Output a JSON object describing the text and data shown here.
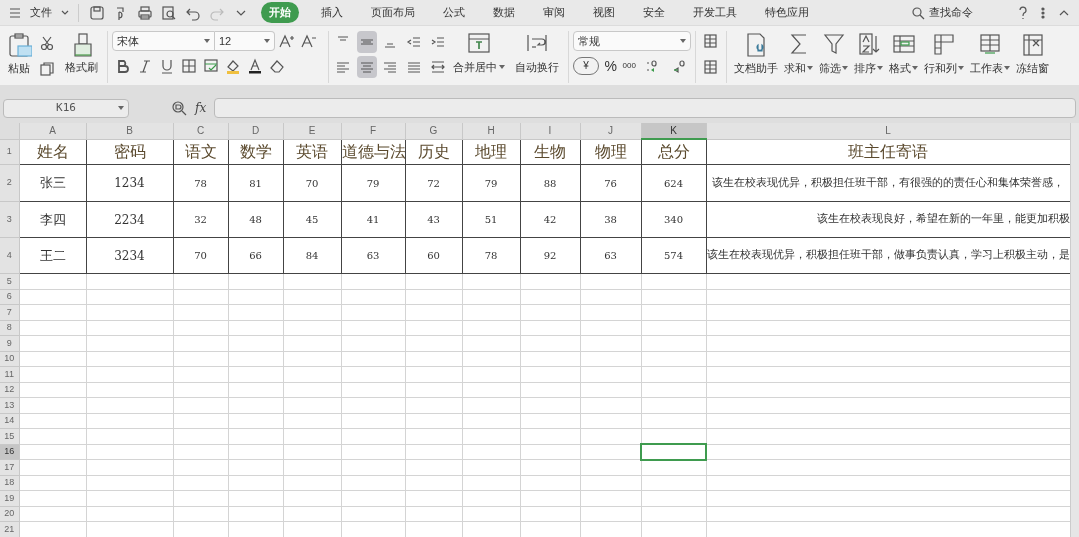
{
  "menu_bar": {
    "file_menu": "文件",
    "tabs": [
      {
        "label": "开始",
        "selected": true
      },
      {
        "label": "插入",
        "selected": false
      },
      {
        "label": "页面布局",
        "selected": false
      },
      {
        "label": "公式",
        "selected": false
      },
      {
        "label": "数据",
        "selected": false
      },
      {
        "label": "审阅",
        "selected": false
      },
      {
        "label": "视图",
        "selected": false
      },
      {
        "label": "安全",
        "selected": false
      },
      {
        "label": "开发工具",
        "selected": false
      },
      {
        "label": "特色应用",
        "selected": false
      }
    ],
    "search": "查找命令"
  },
  "ribbon": {
    "paste": "粘贴",
    "format_painter": "格式刷",
    "font": "宋体",
    "font_size": "12",
    "merge": "合并居中",
    "wrap": "自动换行",
    "number_format": "常规",
    "number_buttons": [
      "¥",
      "%",
      "000"
    ],
    "tools": [
      "文档助手",
      "求和",
      "筛选",
      "排序",
      "格式",
      "行和列",
      "工作表",
      "冻结窗"
    ]
  },
  "formula_bar": {
    "name_box": "K16",
    "fx": "fx"
  },
  "sheet": {
    "columns": [
      {
        "letter": "A",
        "selected": false
      },
      {
        "letter": "B",
        "selected": false
      },
      {
        "letter": "C",
        "selected": false
      },
      {
        "letter": "D",
        "selected": false
      },
      {
        "letter": "E",
        "selected": false
      },
      {
        "letter": "F",
        "selected": false
      },
      {
        "letter": "G",
        "selected": false
      },
      {
        "letter": "H",
        "selected": false
      },
      {
        "letter": "I",
        "selected": false
      },
      {
        "letter": "J",
        "selected": false
      },
      {
        "letter": "K",
        "selected": true
      },
      {
        "letter": "L",
        "selected": false
      }
    ],
    "header_row": [
      "姓名",
      "密码",
      "语文",
      "数学",
      "英语",
      "道德与法",
      "历史",
      "地理",
      "生物",
      "物理",
      "总分",
      "班主任寄语"
    ],
    "rows": [
      [
        "张三",
        "1234",
        "78",
        "81",
        "70",
        "79",
        "72",
        "79",
        "88",
        "76",
        "624",
        "该生在校表现优异，积极担任班干部，有很强的的责任心和集体荣誉感，"
      ],
      [
        "李四",
        "2234",
        "32",
        "48",
        "45",
        "41",
        "43",
        "51",
        "42",
        "38",
        "340",
        "该生在校表现良好，希望在新的一年里，能更加积极"
      ],
      [
        "王二",
        "3234",
        "70",
        "66",
        "84",
        "63",
        "60",
        "78",
        "92",
        "63",
        "574",
        "该生在校表现优异，积极担任班干部，做事负责认真，学习上积极主动，是"
      ]
    ],
    "row_numbers": [
      {
        "label": "1",
        "selected": false
      },
      {
        "label": "2",
        "selected": false
      },
      {
        "label": "3",
        "selected": false
      },
      {
        "label": "4",
        "selected": false
      },
      {
        "label": "5",
        "selected": false
      },
      {
        "label": "6",
        "selected": false
      },
      {
        "label": "7",
        "selected": false
      },
      {
        "label": "8",
        "selected": false
      },
      {
        "label": "9",
        "selected": false
      },
      {
        "label": "10",
        "selected": false
      },
      {
        "label": "11",
        "selected": false
      },
      {
        "label": "12",
        "selected": false
      },
      {
        "label": "13",
        "selected": false
      },
      {
        "label": "14",
        "selected": false
      },
      {
        "label": "15",
        "selected": false
      },
      {
        "label": "16",
        "selected": true
      },
      {
        "label": "17",
        "selected": false
      },
      {
        "label": "18",
        "selected": false
      },
      {
        "label": "19",
        "selected": false
      },
      {
        "label": "20",
        "selected": false
      },
      {
        "label": "21",
        "selected": false
      }
    ]
  }
}
